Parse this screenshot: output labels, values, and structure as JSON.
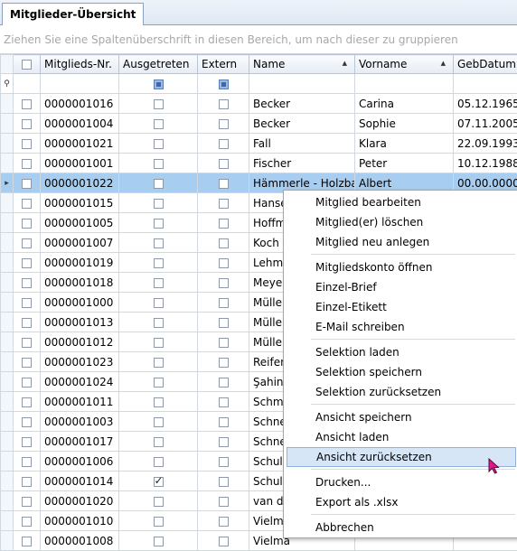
{
  "tab": {
    "label": "Mitglieder-Übersicht"
  },
  "group_panel": {
    "hint": "Ziehen Sie eine Spaltenüberschrift in diesen Bereich, um nach dieser zu gruppieren"
  },
  "columns": {
    "nr": "Mitglieds-Nr.",
    "ausgetreten": "Ausgetreten",
    "extern": "Extern",
    "name": "Name",
    "vorname": "Vorname",
    "geb": "GebDatum"
  },
  "rows": [
    {
      "nr": "0000001016",
      "name": "Becker",
      "vorname": "Carina",
      "geb": "05.12.1965",
      "ausgetreten": false
    },
    {
      "nr": "0000001004",
      "name": "Becker",
      "vorname": "Sophie",
      "geb": "07.11.2005",
      "ausgetreten": false
    },
    {
      "nr": "0000001021",
      "name": "Fall",
      "vorname": "Klara",
      "geb": "22.09.1993",
      "ausgetreten": false
    },
    {
      "nr": "0000001001",
      "name": "Fischer",
      "vorname": "Peter",
      "geb": "10.12.1988",
      "ausgetreten": false
    },
    {
      "nr": "0000001022",
      "name": "Hämmerle - Holzbau",
      "vorname": "Albert",
      "geb": "00.00.0000",
      "ausgetreten": false,
      "selected": true
    },
    {
      "nr": "0000001015",
      "name": "Hanse",
      "vorname": "",
      "geb": "",
      "ausgetreten": false
    },
    {
      "nr": "0000001005",
      "name": "Hoffm",
      "vorname": "",
      "geb": "",
      "ausgetreten": false
    },
    {
      "nr": "0000001007",
      "name": "Koch",
      "vorname": "",
      "geb": "",
      "ausgetreten": false
    },
    {
      "nr": "0000001019",
      "name": "Lehma",
      "vorname": "",
      "geb": "",
      "ausgetreten": false
    },
    {
      "nr": "0000001018",
      "name": "Meyer",
      "vorname": "",
      "geb": "",
      "ausgetreten": false
    },
    {
      "nr": "0000001000",
      "name": "Müller",
      "vorname": "",
      "geb": "",
      "ausgetreten": false
    },
    {
      "nr": "0000001013",
      "name": "Müller",
      "vorname": "",
      "geb": "",
      "ausgetreten": false
    },
    {
      "nr": "0000001012",
      "name": "Müller",
      "vorname": "",
      "geb": "",
      "ausgetreten": false
    },
    {
      "nr": "0000001023",
      "name": "Reifen",
      "vorname": "",
      "geb": "",
      "ausgetreten": false
    },
    {
      "nr": "0000001024",
      "name": "Şahin",
      "vorname": "",
      "geb": "",
      "ausgetreten": false
    },
    {
      "nr": "0000001011",
      "name": "Schmic",
      "vorname": "",
      "geb": "",
      "ausgetreten": false
    },
    {
      "nr": "0000001003",
      "name": "Schne",
      "vorname": "",
      "geb": "",
      "ausgetreten": false
    },
    {
      "nr": "0000001017",
      "name": "Schne",
      "vorname": "",
      "geb": "",
      "ausgetreten": false
    },
    {
      "nr": "0000001006",
      "name": "Schulz",
      "vorname": "",
      "geb": "",
      "ausgetreten": false
    },
    {
      "nr": "0000001014",
      "name": "Schulz",
      "vorname": "",
      "geb": "",
      "ausgetreten": true
    },
    {
      "nr": "0000001020",
      "name": "van de",
      "vorname": "",
      "geb": "",
      "ausgetreten": false
    },
    {
      "nr": "0000001010",
      "name": "Vielma",
      "vorname": "",
      "geb": "",
      "ausgetreten": false
    },
    {
      "nr": "0000001008",
      "name": "Vielma",
      "vorname": "",
      "geb": "",
      "ausgetreten": false
    }
  ],
  "menu": {
    "edit": "Mitglied bearbeiten",
    "delete": "Mitglied(er) löschen",
    "new": "Mitglied neu anlegen",
    "account": "Mitgliedskonto öffnen",
    "letter": "Einzel-Brief",
    "label": "Einzel-Etikett",
    "email": "E-Mail schreiben",
    "sel_load": "Selektion laden",
    "sel_save": "Selektion speichern",
    "sel_reset": "Selektion zurücksetzen",
    "view_save": "Ansicht speichern",
    "view_load": "Ansicht laden",
    "view_reset": "Ansicht zurücksetzen",
    "print": "Drucken...",
    "export": "Export als .xlsx",
    "cancel": "Abbrechen"
  },
  "colors": {
    "selection": "#a7cdf0",
    "menu_highlight": "#d6e6f7",
    "cursor": "#e0168c"
  }
}
